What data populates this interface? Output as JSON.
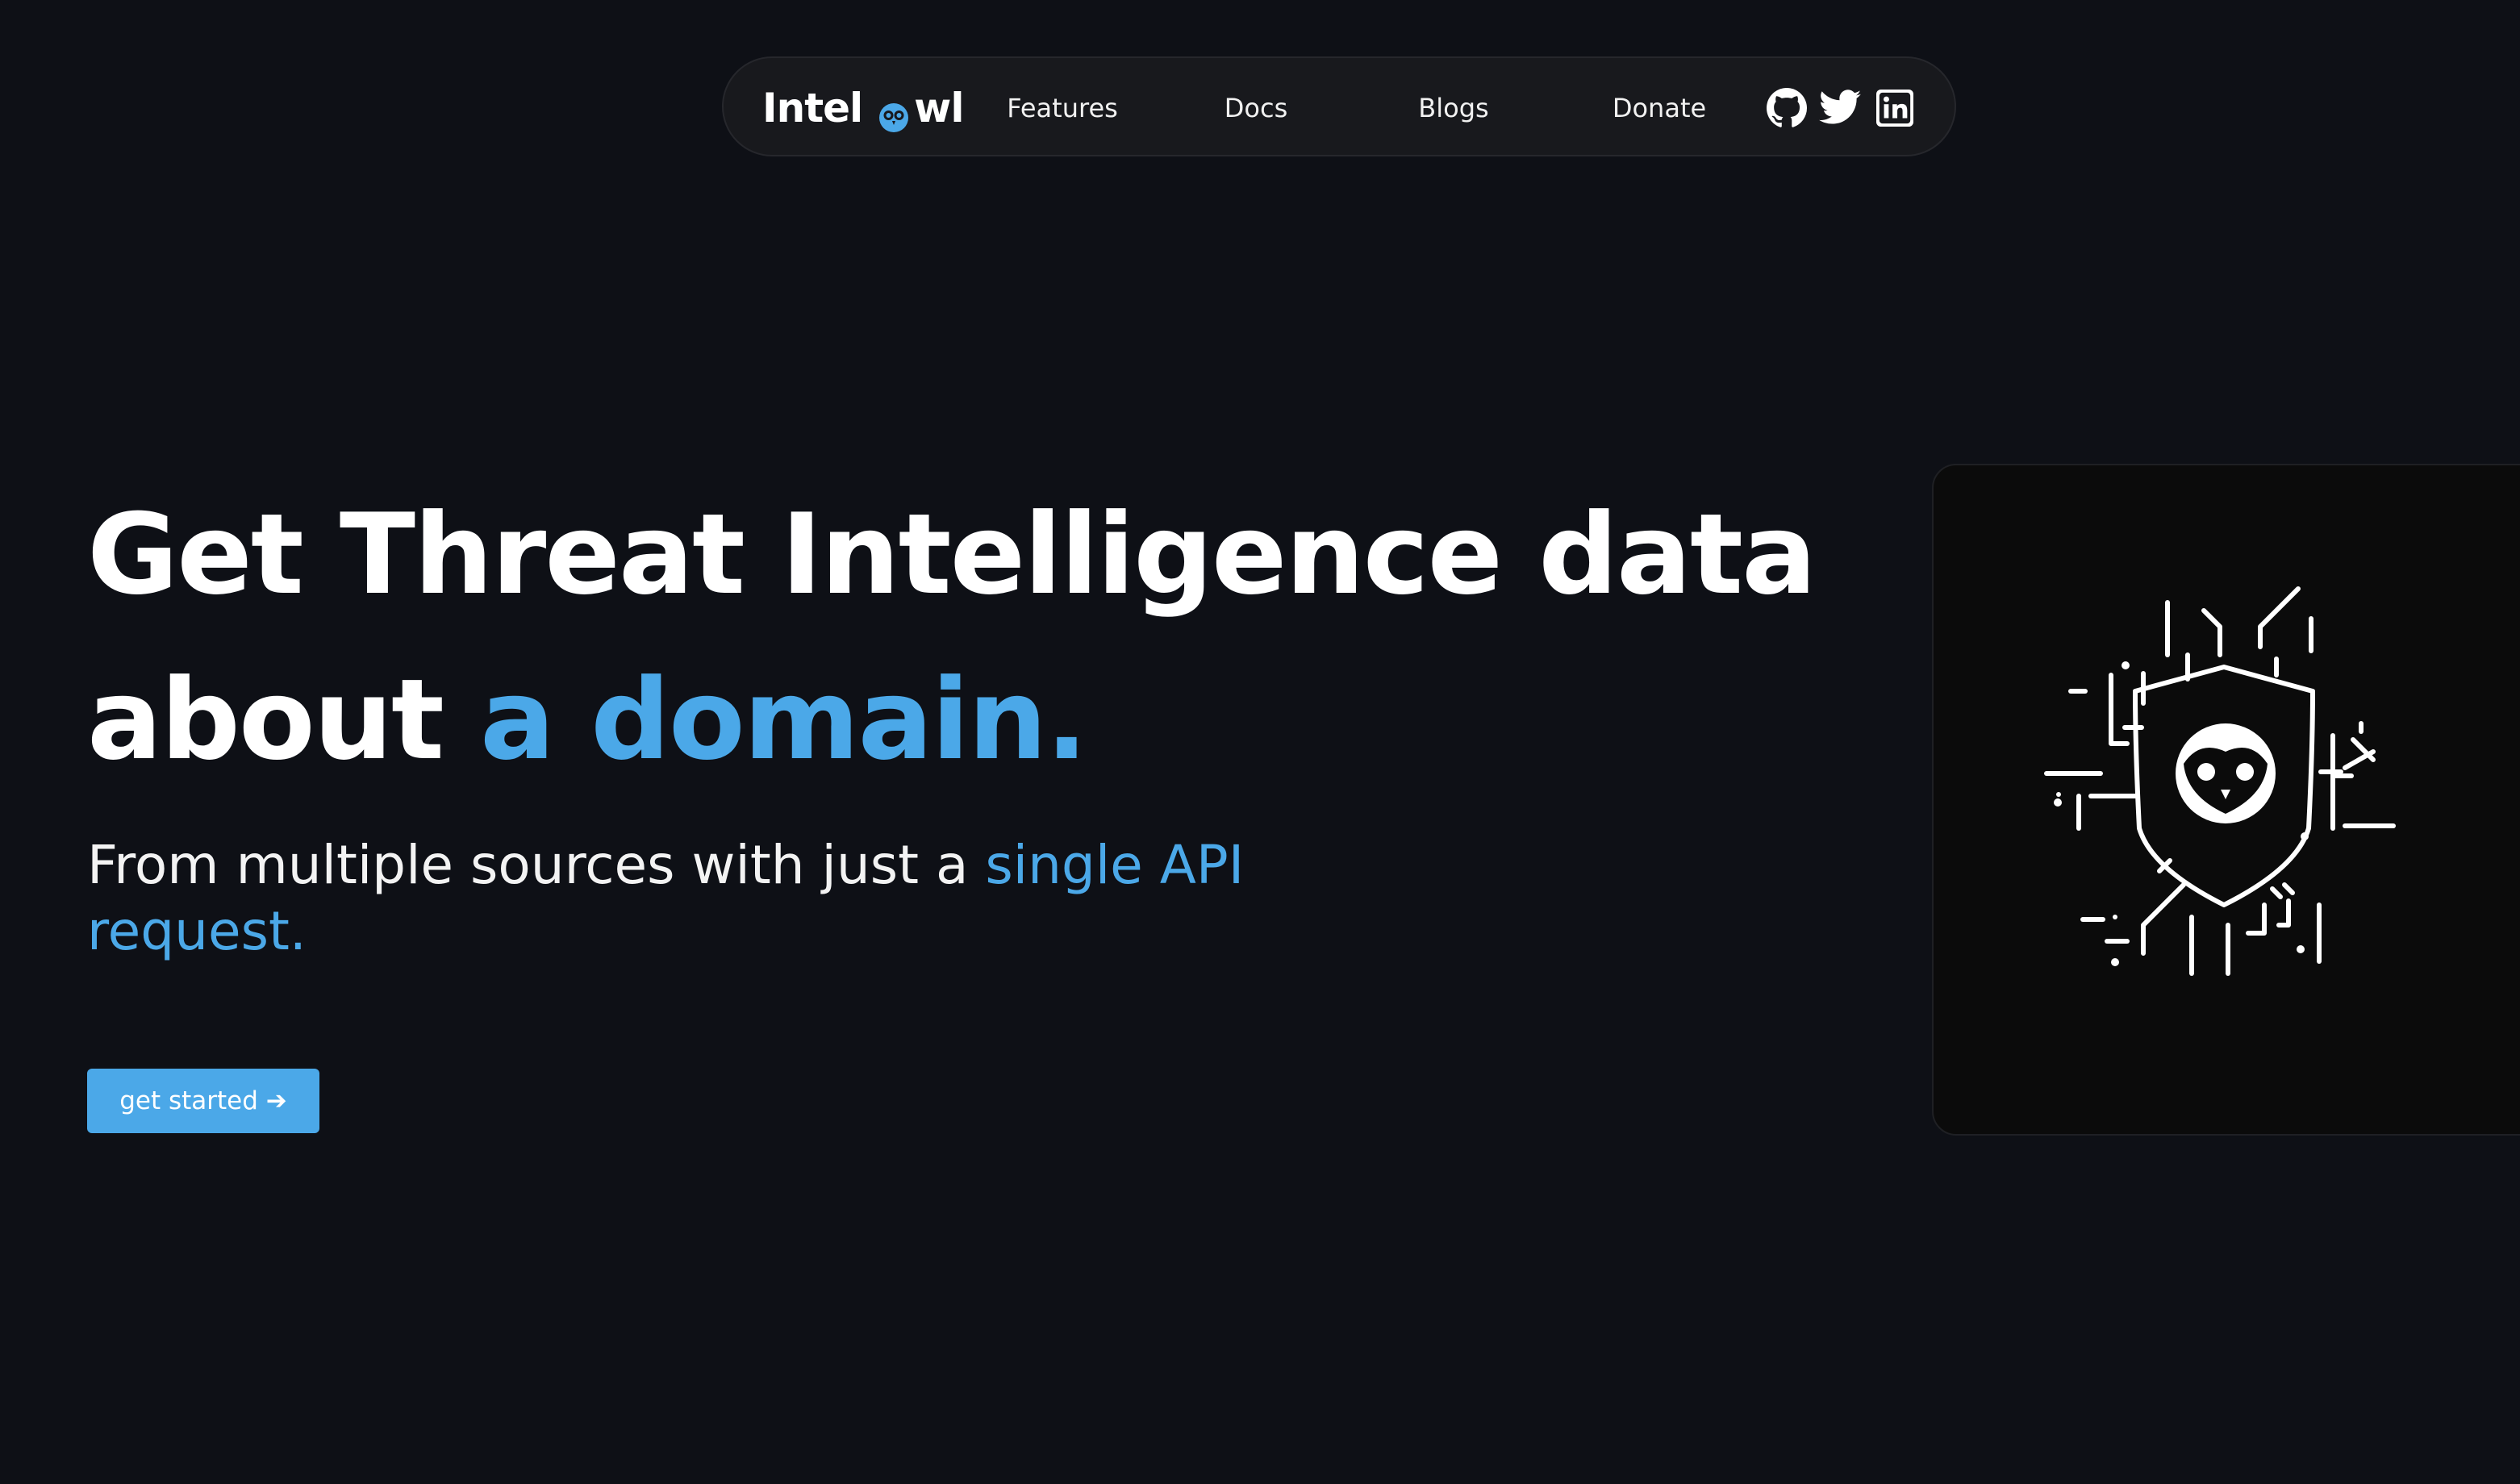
{
  "nav": {
    "brand": {
      "part1": "Intel",
      "part2": "wl",
      "icon": "owl-logo-icon"
    },
    "links": [
      {
        "label": "Features"
      },
      {
        "label": "Docs"
      },
      {
        "label": "Blogs"
      },
      {
        "label": "Donate"
      }
    ],
    "social": [
      {
        "icon": "github-icon"
      },
      {
        "icon": "twitter-icon"
      },
      {
        "icon": "linkedin-icon"
      }
    ]
  },
  "hero": {
    "title_line1": "Get Threat Intelligence data",
    "title_line2_prefix": "about ",
    "title_line2_accent": "a domain.",
    "subtitle_prefix": "From multiple sources with just a ",
    "subtitle_accent": "single API request.",
    "cta_label": "get started ➔"
  },
  "illustration": {
    "icon": "owl-shield-circuit-icon"
  },
  "colors": {
    "background": "#0e1016",
    "accent": "#4ba8e8",
    "nav_background": "#18191d",
    "card_background": "#0b0b0b"
  }
}
